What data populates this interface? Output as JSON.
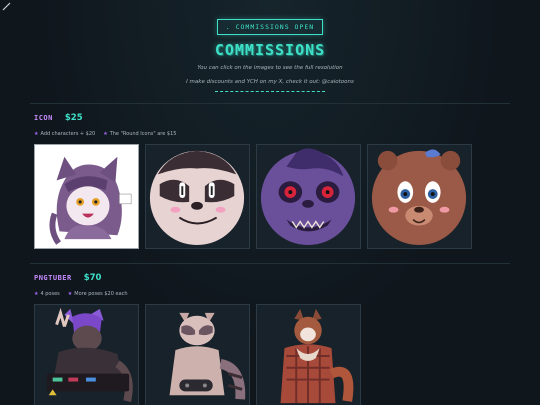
{
  "header": {
    "badge": ". COMMISSIONS OPEN",
    "title": "COMMISSIONS",
    "line1": "You can click on the images to see the full resolution",
    "line2": "I make discounts and YCH on my X, check it out: @caiotoons"
  },
  "sections": [
    {
      "name": "ICON",
      "price": "$25",
      "notes": [
        "Add characters + $20",
        "The \"Round Icons\" are $15"
      ],
      "cards": [
        "wolf-girl-icon",
        "raccoon-round-icon",
        "purple-monster-round-icon",
        "bear-round-icon"
      ]
    },
    {
      "name": "PNGTUBER",
      "price": "$70",
      "notes": [
        "4 poses",
        "More poses $20 each"
      ],
      "cards": [
        "wolf-keyboard-pngtuber",
        "raccoon-gamer-pngtuber",
        "fox-pngtuber"
      ]
    }
  ],
  "colors": {
    "accent": "#3ee0c8",
    "section_label": "#c78bff",
    "background": "#0f171d"
  }
}
